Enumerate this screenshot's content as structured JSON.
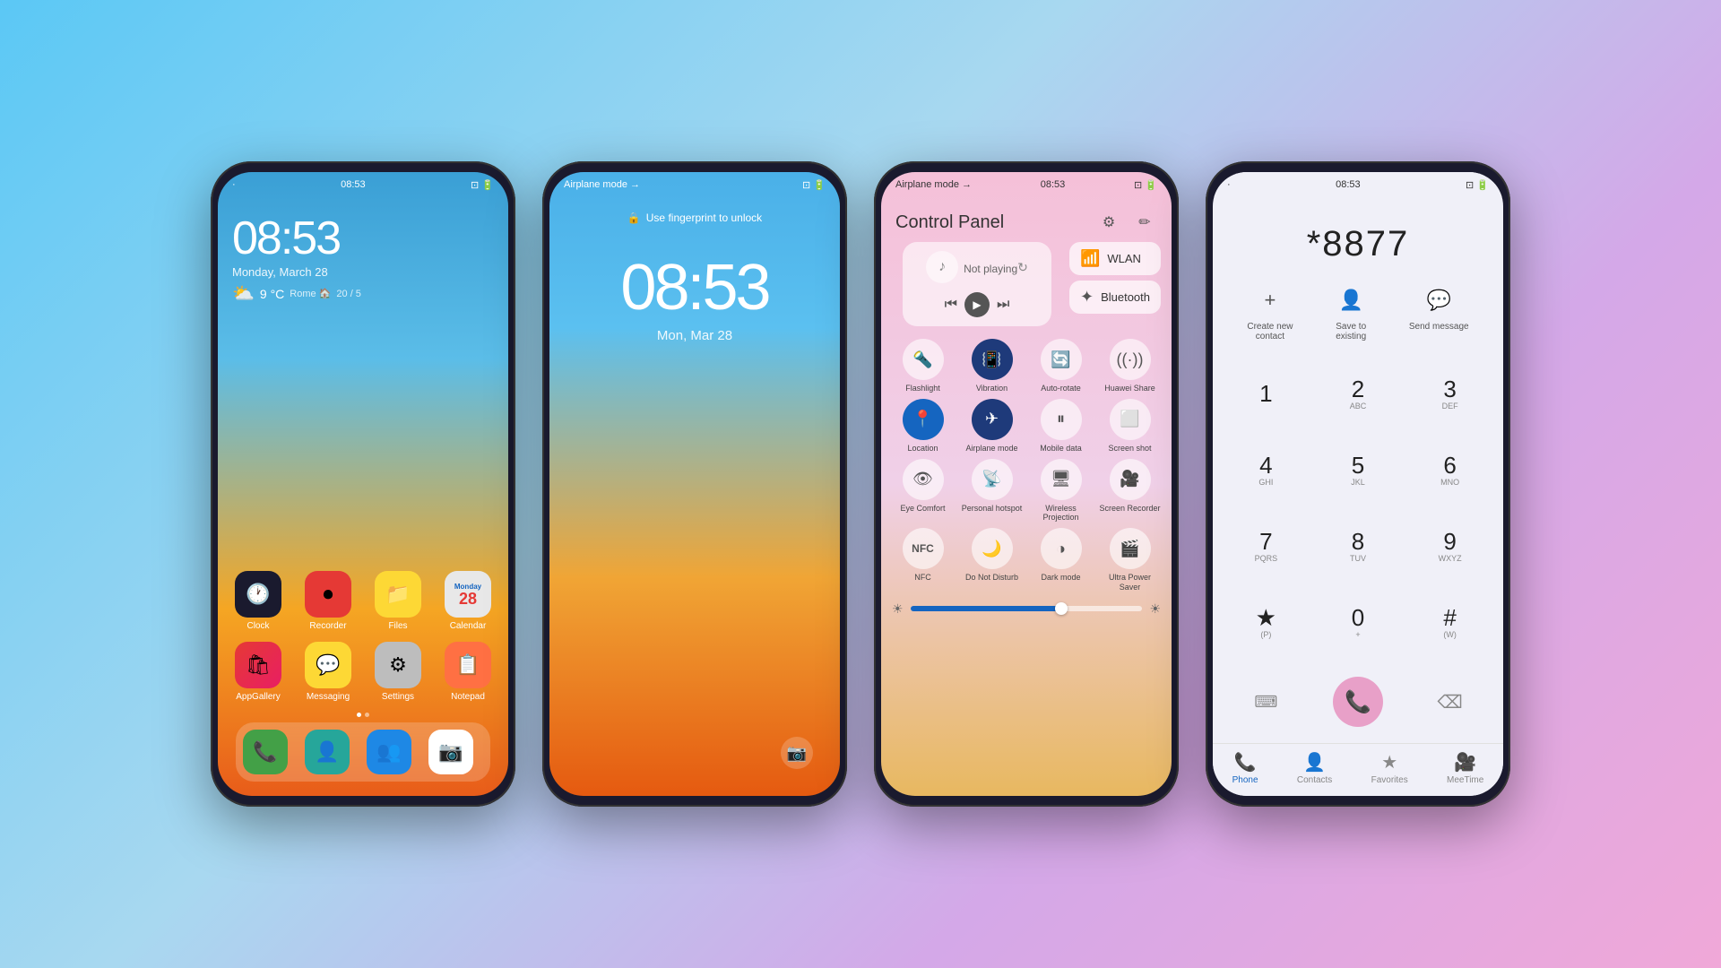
{
  "background": {
    "gradient": "linear-gradient(135deg, #5bc8f5, #a8d8f0, #d4a8e8, #f0a8d8)"
  },
  "phone1": {
    "status": {
      "left": "·",
      "time": "08:53",
      "icons": "⊡ 🔋"
    },
    "clock": "08:53",
    "date": "Monday, March 28",
    "weather": {
      "icon": "⛅",
      "temp": "9 °C",
      "location": "Rome 🏠",
      "forecast": "20 / 5"
    },
    "apps": [
      {
        "name": "Clock",
        "icon": "🕐",
        "bg": "#1a1a2e",
        "label": "Clock"
      },
      {
        "name": "Recorder",
        "icon": "⏺",
        "bg": "#e53935",
        "label": "Recorder"
      },
      {
        "name": "Files",
        "icon": "📁",
        "bg": "#fdd835",
        "label": "Files"
      },
      {
        "name": "Calendar",
        "icon": "📅",
        "bg": "#e8e8e8",
        "label": "Calendar"
      },
      {
        "name": "AppGallery",
        "icon": "🛍",
        "bg": "#e53935",
        "label": "AppGallery"
      },
      {
        "name": "Messaging",
        "icon": "💬",
        "bg": "#fdd835",
        "label": "Messaging"
      },
      {
        "name": "Settings",
        "icon": "⚙",
        "bg": "#bdbdbd",
        "label": "Settings"
      },
      {
        "name": "Notepad",
        "icon": "📋",
        "bg": "#ff7043",
        "label": "Notepad"
      }
    ],
    "dock": [
      {
        "name": "Phone",
        "icon": "📞",
        "bg": "#43a047"
      },
      {
        "name": "Contacts",
        "icon": "👤",
        "bg": "#26a69a"
      },
      {
        "name": "Contacts2",
        "icon": "👥",
        "bg": "#1e88e5"
      },
      {
        "name": "Camera",
        "icon": "📷",
        "bg": "#fff"
      }
    ]
  },
  "phone2": {
    "status": {
      "mode": "Airplane mode →",
      "icons": "⊡ 🔋"
    },
    "fingerprint": "🔒 Use fingerprint to unlock",
    "clock": "08:53",
    "date": "Mon, Mar 28"
  },
  "phone3": {
    "status": {
      "mode": "Airplane mode →",
      "time": "08:53",
      "icons": "⊡ 🔋"
    },
    "title": "Control Panel",
    "media": {
      "status": "Not playing"
    },
    "wlan": "WLAN",
    "bluetooth": "Bluetooth",
    "tiles_row1": [
      {
        "label": "Flashlight",
        "active": false
      },
      {
        "label": "Vibration",
        "active": true
      },
      {
        "label": "Auto-rotate",
        "active": false
      },
      {
        "label": "Huawei Share",
        "active": false
      }
    ],
    "tiles_row2": [
      {
        "label": "Location",
        "active": true
      },
      {
        "label": "Airplane mode",
        "active": true
      },
      {
        "label": "Mobile data",
        "active": false
      },
      {
        "label": "Screen shot",
        "active": false
      }
    ],
    "tiles_row3": [
      {
        "label": "Eye Comfort",
        "active": false
      },
      {
        "label": "Personal hotspot",
        "active": false
      },
      {
        "label": "Wireless Projection",
        "active": false
      },
      {
        "label": "Screen Recorder",
        "active": false
      }
    ],
    "tiles_row4": [
      {
        "label": "NFC",
        "active": false
      },
      {
        "label": "Do Not Disturb",
        "active": false
      },
      {
        "label": "Dark mode",
        "active": false
      },
      {
        "label": "Ultra Power Saver",
        "active": false
      }
    ],
    "brightness": 65
  },
  "phone4": {
    "status": {
      "left": "·",
      "time": "08:53",
      "icons": "⊡ 🔋"
    },
    "number": "*8877",
    "actions": [
      {
        "label": "Create new contact",
        "icon": "+"
      },
      {
        "label": "Save to existing",
        "icon": "👤"
      },
      {
        "label": "Send message",
        "icon": "💬"
      }
    ],
    "keypad": [
      {
        "num": "1",
        "letters": ""
      },
      {
        "num": "2",
        "letters": "ABC"
      },
      {
        "num": "3",
        "letters": "DEF"
      },
      {
        "num": "4",
        "letters": "GHI"
      },
      {
        "num": "5",
        "letters": "JKL"
      },
      {
        "num": "6",
        "letters": "MNO"
      },
      {
        "num": "7",
        "letters": "PQRS"
      },
      {
        "num": "8",
        "letters": "TUV"
      },
      {
        "num": "9",
        "letters": "WXYZ"
      },
      {
        "num": "★",
        "letters": "(P)"
      },
      {
        "num": "0",
        "letters": "+"
      },
      {
        "num": "#",
        "letters": "(W)"
      }
    ],
    "nav": [
      {
        "label": "Phone",
        "active": true
      },
      {
        "label": "Contacts",
        "active": false
      },
      {
        "label": "Favorites",
        "active": false
      },
      {
        "label": "MeeTime",
        "active": false
      }
    ]
  }
}
